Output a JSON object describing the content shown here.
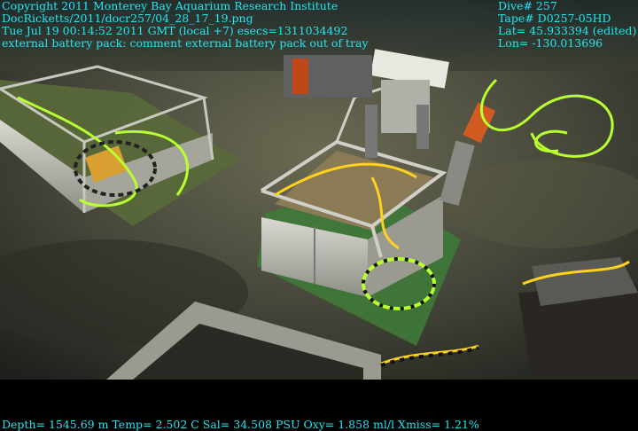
{
  "overlay": {
    "top_left": [
      "Copyright 2011 Monterey Bay Aquarium Research Institute",
      "DocRicketts/2011/docr257/04_28_17_19.png",
      "Tue Jul 19 00:14:52 2011 GMT (local +7)  esecs=1311034492",
      "external battery pack: comment external battery pack out of tray"
    ],
    "top_right": [
      "Dive# 257",
      "Tape# D0257-05HD",
      "Lat= 45.933394 (edited)",
      "Lon= -130.013696"
    ],
    "bottom": "Depth= 1545.69 m  Temp= 2.502 C  Sal= 34.508 PSU  Oxy= 1.858 ml/l  Xmiss= 1.21%"
  },
  "colors": {
    "overlay_text": "#22e6f0",
    "seafloor": "#4a4a3a",
    "cable": "#b7ff2e"
  }
}
